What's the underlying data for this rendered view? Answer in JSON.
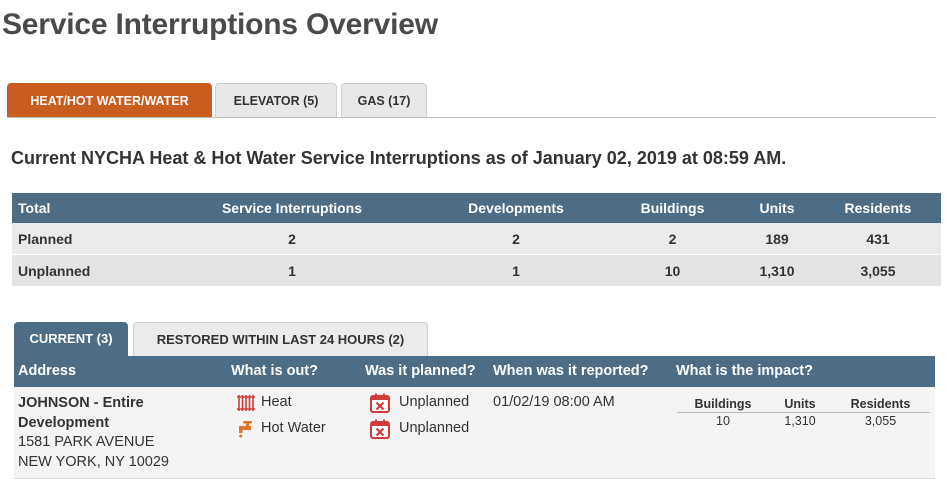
{
  "page": {
    "title": "Service Interruptions Overview"
  },
  "top_tabs": [
    {
      "label": "HEAT/HOT WATER/WATER",
      "active": true
    },
    {
      "label": "ELEVATOR (5)",
      "active": false
    },
    {
      "label": "GAS (17)",
      "active": false
    }
  ],
  "subtitle": "Current NYCHA Heat & Hot Water Service Interruptions as of January 02, 2019 at 08:59 AM.",
  "summary": {
    "headers": [
      "Total",
      "Service Interruptions",
      "Developments",
      "Buildings",
      "Units",
      "Residents"
    ],
    "rows": [
      [
        "Planned",
        "2",
        "2",
        "2",
        "189",
        "431"
      ],
      [
        "Unplanned",
        "1",
        "1",
        "10",
        "1,310",
        "3,055"
      ]
    ]
  },
  "sub_tabs": [
    {
      "label": "CURRENT (3)",
      "active": true
    },
    {
      "label": "RESTORED WITHIN LAST 24 HOURS (2)",
      "active": false
    }
  ],
  "detail": {
    "headers": [
      "Address",
      "What is out?",
      "Was it planned?",
      "When was it reported?",
      "What is the impact?"
    ],
    "rows": [
      {
        "name_line1": "JOHNSON - Entire",
        "name_line2": "Development",
        "street": "1581 PARK AVENUE",
        "city": "NEW YORK, NY 10029",
        "outages": [
          {
            "icon": "radiator-icon",
            "label": "Heat"
          },
          {
            "icon": "faucet-icon",
            "label": "Hot Water"
          }
        ],
        "planned": [
          {
            "icon": "calendar-x-icon",
            "label": "Unplanned"
          },
          {
            "icon": "calendar-x-icon",
            "label": "Unplanned"
          }
        ],
        "reported": "01/02/19 08:00 AM",
        "impact": {
          "headers": [
            "Buildings",
            "Units",
            "Residents"
          ],
          "values": [
            "10",
            "1,310",
            "3,055"
          ]
        }
      }
    ]
  },
  "colors": {
    "accent": "#c95d1f",
    "header_blue": "#4d6d86",
    "icon_red": "#d33a3a",
    "icon_orange": "#e0742a"
  }
}
